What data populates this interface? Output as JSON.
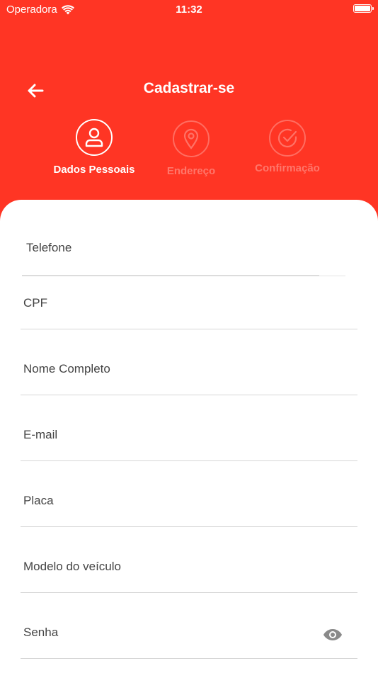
{
  "status_bar": {
    "carrier": "Operadora",
    "time": "11:32"
  },
  "header": {
    "title": "Cadastrar-se"
  },
  "steps": [
    {
      "label": "Dados Pessoais",
      "icon": "user-icon",
      "active": true
    },
    {
      "label": "Endereço",
      "icon": "location-pin-icon",
      "active": false
    },
    {
      "label": "Confirmação",
      "icon": "check-circle-icon",
      "active": false
    }
  ],
  "form": {
    "fields": [
      {
        "placeholder": "Telefone",
        "value": ""
      },
      {
        "placeholder": "CPF",
        "value": ""
      },
      {
        "placeholder": "Nome Completo",
        "value": ""
      },
      {
        "placeholder": "E-mail",
        "value": ""
      },
      {
        "placeholder": "Placa",
        "value": ""
      },
      {
        "placeholder": "Modelo do veículo",
        "value": ""
      },
      {
        "placeholder": "Senha",
        "value": "",
        "icon": "eye-icon"
      }
    ]
  },
  "colors": {
    "primary": "#ff3524",
    "card": "#ffffff",
    "divider": "#d6d6d6",
    "icon_gray": "#888888"
  }
}
